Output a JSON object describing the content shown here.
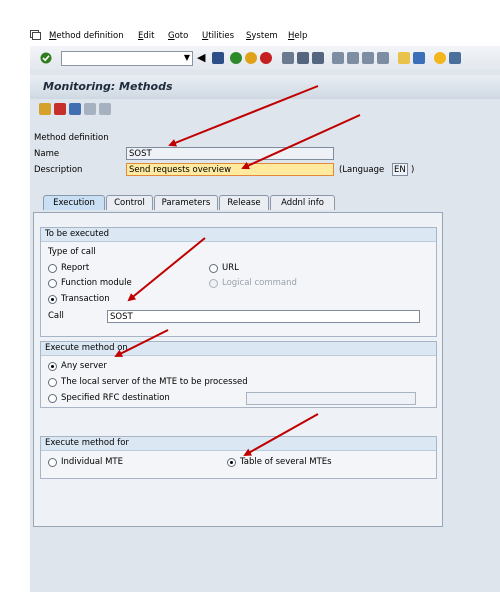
{
  "menu": [
    "Method definition",
    "Edit",
    "Goto",
    "Utilities",
    "System",
    "Help"
  ],
  "title": "Monitoring: Methods",
  "form": {
    "section_label": "Method definition",
    "name_label": "Name",
    "name_value": "SOST",
    "description_label": "Description",
    "description_value": "Send requests overview",
    "language_label": "(Language",
    "language_value": "EN",
    "language_close": ")"
  },
  "tabs": [
    "Execution",
    "Control",
    "Parameters",
    "Release",
    "Addnl info"
  ],
  "groups": {
    "to_be_executed": {
      "title": "To be executed",
      "type_of_call": "Type of call",
      "options": [
        "Report",
        "Function module",
        "Transaction",
        "URL",
        "Logical command"
      ],
      "selected": "Transaction",
      "call_label": "Call",
      "call_value": "SOST"
    },
    "execute_on": {
      "title": "Execute method on",
      "options": [
        "Any server",
        "The local server of the MTE to be processed",
        "Specified RFC destination"
      ],
      "selected": "Any server"
    },
    "execute_for": {
      "title": "Execute method for",
      "options": [
        "Individual MTE",
        "Table of several MTEs"
      ],
      "selected": "Table of several MTEs"
    }
  },
  "colors": {
    "arrow": "#c00000",
    "tab_active": "#c9dff3",
    "highlight_field": "#ffeaa0"
  },
  "icons": {
    "sysmenu": "sap-system-menu-icon",
    "toolbar": [
      "enter-check-icon",
      "save-icon",
      "back-icon",
      "exit-icon",
      "cancel-icon",
      "print-icon",
      "find-icon",
      "find-next-icon",
      "first-page-icon",
      "prev-page-icon",
      "next-page-icon",
      "last-page-icon",
      "new-session-icon",
      "shortcut-icon",
      "help-icon",
      "layout-icon"
    ],
    "app": [
      "change-icon",
      "transport-icon",
      "where-used-icon",
      "copy-icon",
      "delete-icon"
    ]
  }
}
